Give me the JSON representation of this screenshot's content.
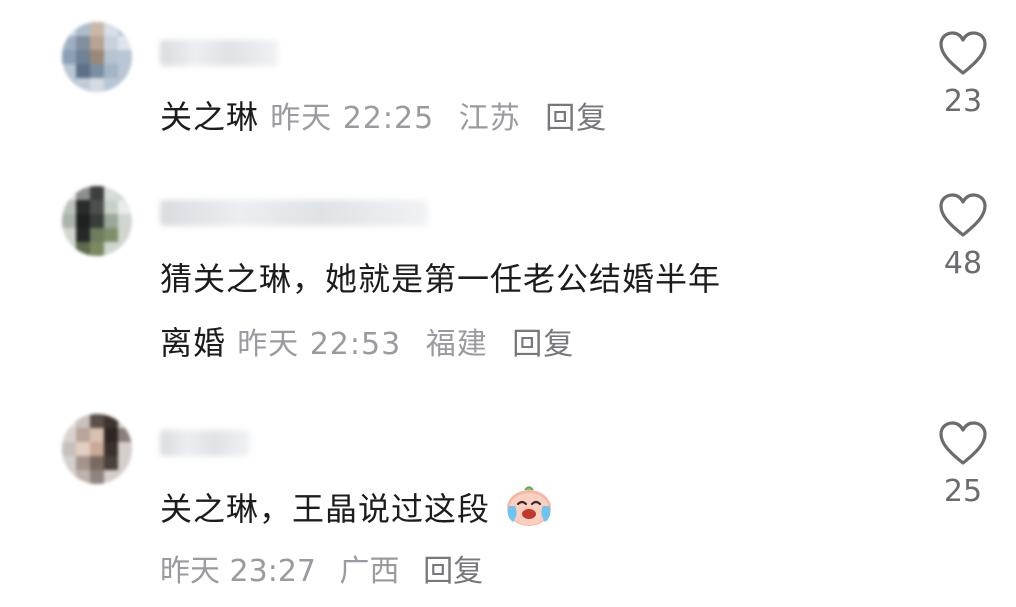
{
  "comments": [
    {
      "text": "关之琳",
      "time": "昨天 22:25",
      "location": "江苏",
      "reply": "回复",
      "likes": "23"
    },
    {
      "text_line1": "猜关之琳，她就是第一任老公结婚半年",
      "text_line2": "离婚",
      "time": "昨天 22:53",
      "location": "福建",
      "reply": "回复",
      "likes": "48"
    },
    {
      "text": "关之琳，王晶说过这段",
      "emoji": "crying-face-emoji",
      "time": "昨天 23:27",
      "location": "广西",
      "reply": "回复",
      "likes": "25"
    }
  ],
  "colors": {
    "text": "#1c1c1e",
    "meta": "#9a9aa0",
    "like_icon": "#6b6b70"
  }
}
